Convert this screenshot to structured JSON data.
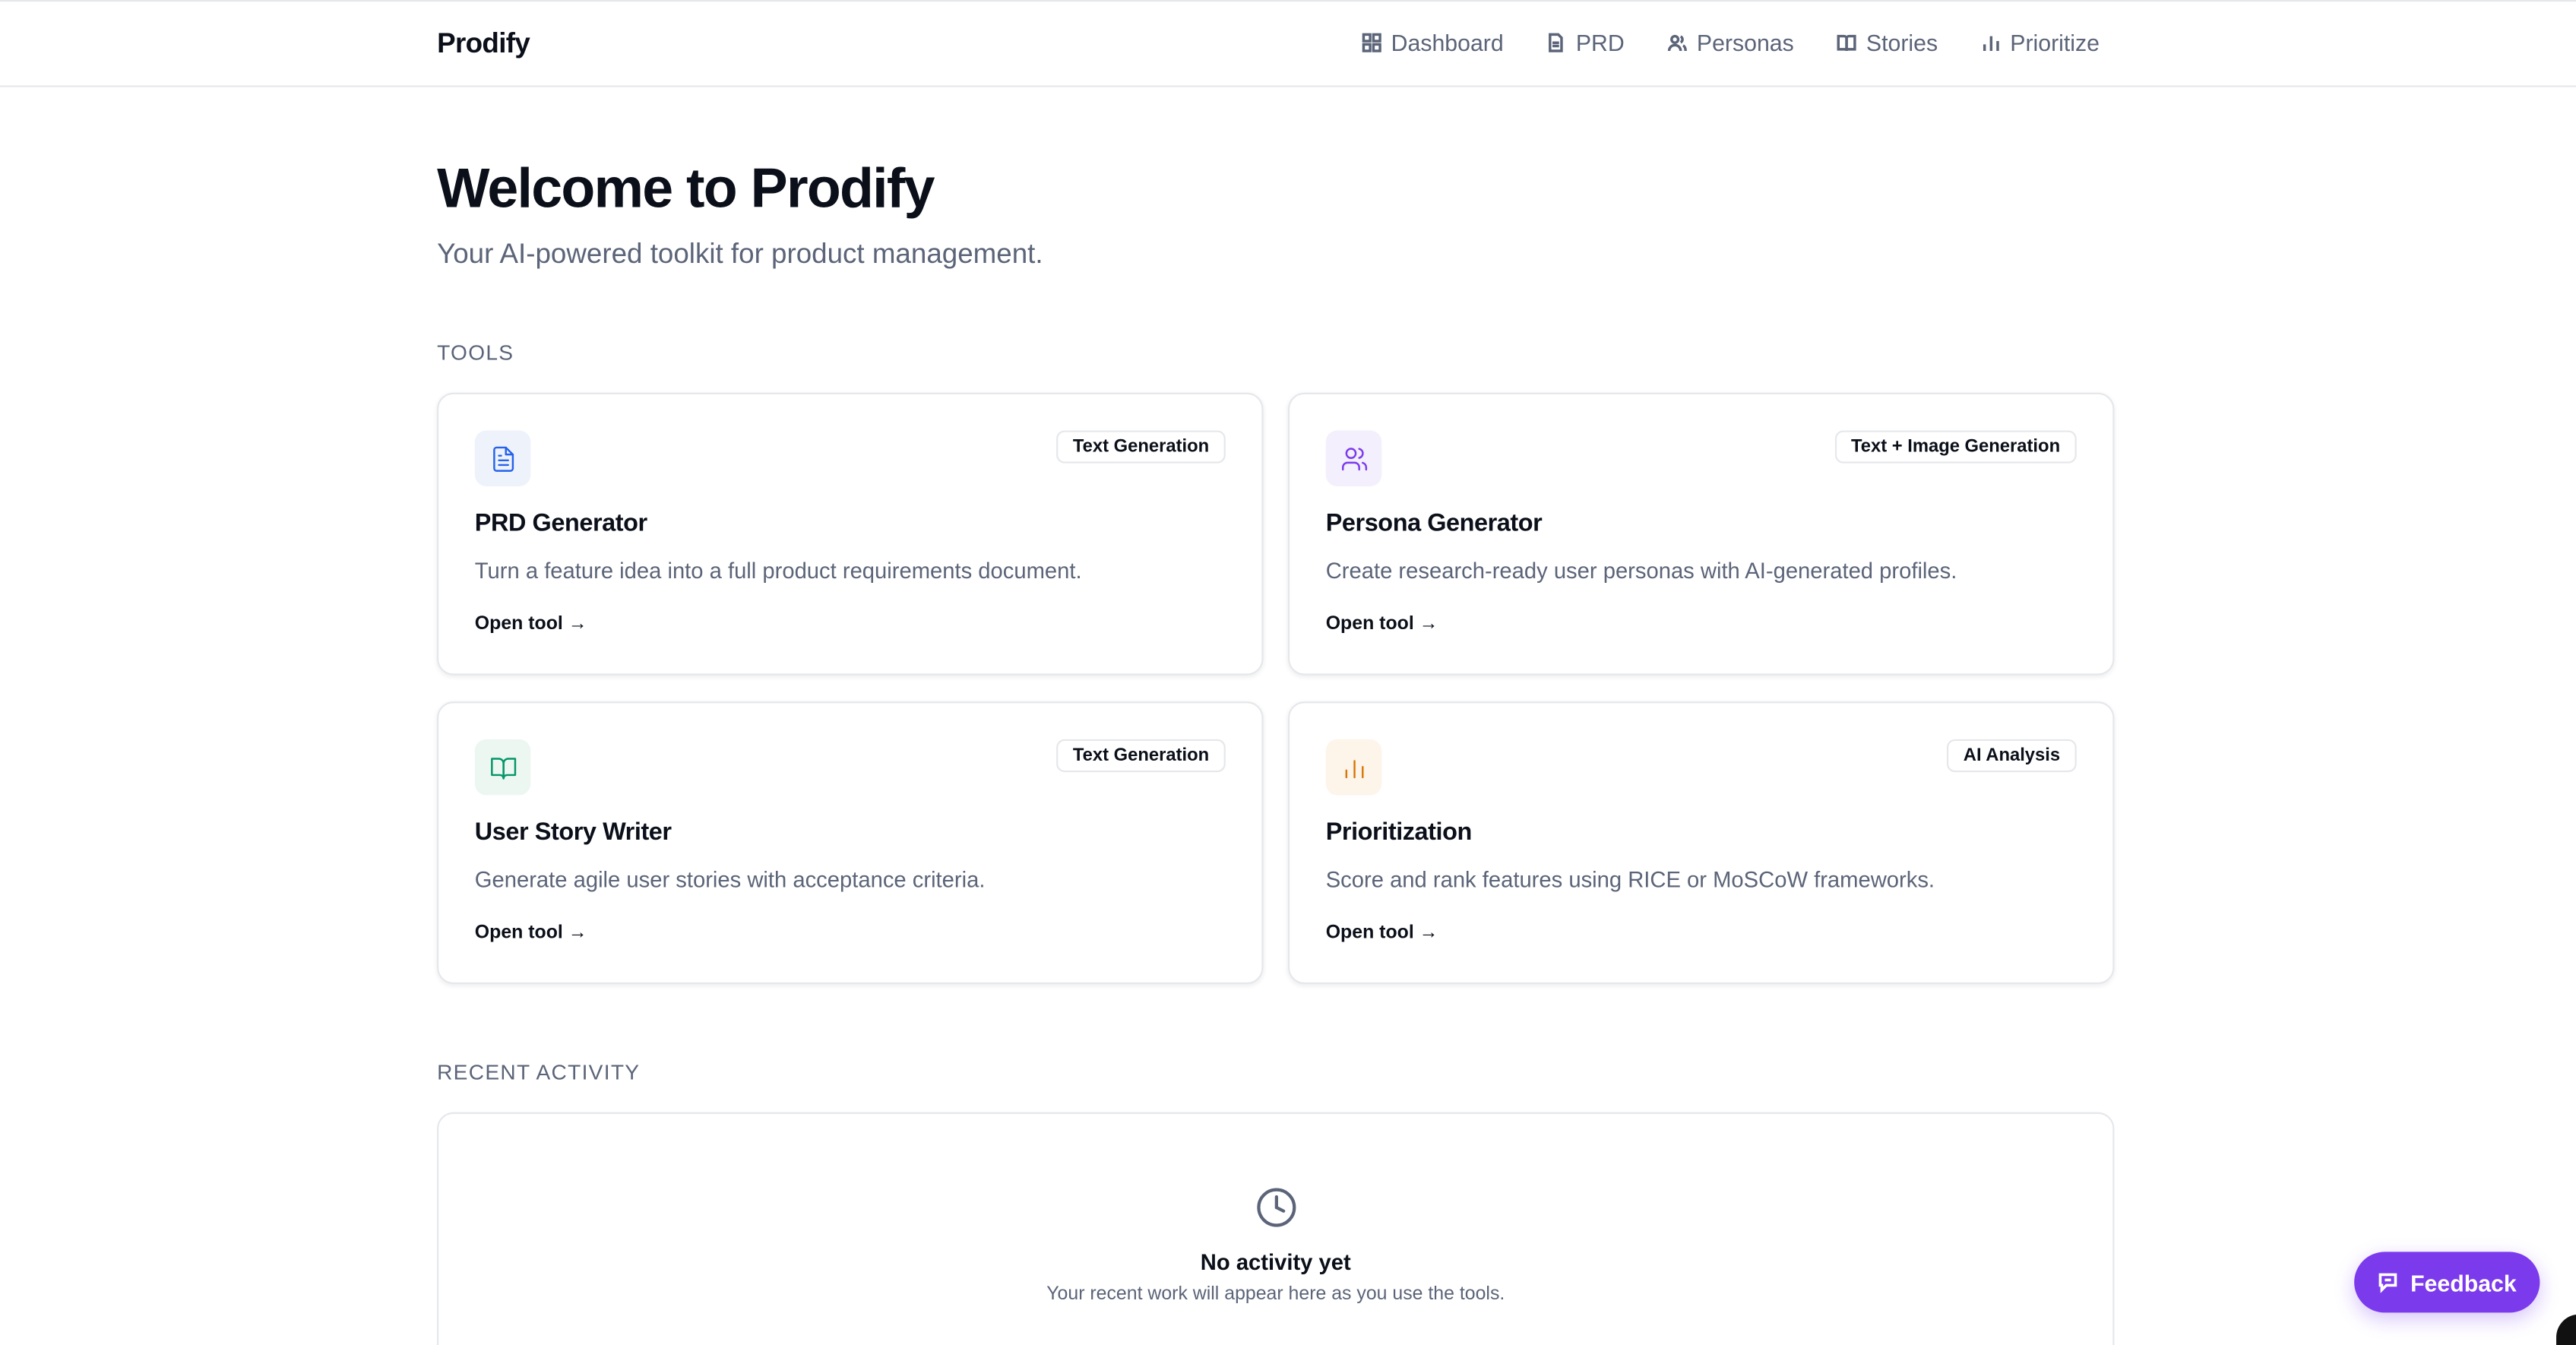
{
  "brand": "Prodify",
  "nav": [
    {
      "label": "Dashboard",
      "icon": "grid-icon"
    },
    {
      "label": "PRD",
      "icon": "document-icon"
    },
    {
      "label": "Personas",
      "icon": "users-icon"
    },
    {
      "label": "Stories",
      "icon": "book-icon"
    },
    {
      "label": "Prioritize",
      "icon": "bar-chart-icon"
    }
  ],
  "hero": {
    "title": "Welcome to Prodify",
    "subtitle": "Your AI-powered toolkit for product management."
  },
  "tools_label": "TOOLS",
  "tools": [
    {
      "title": "PRD Generator",
      "badge": "Text Generation",
      "description": "Turn a feature idea into a full product requirements document.",
      "link": "Open tool →",
      "icon": "document-icon",
      "color": "#2563eb",
      "bg": "#eef2fb"
    },
    {
      "title": "Persona Generator",
      "badge": "Text + Image Generation",
      "description": "Create research-ready user personas with AI-generated profiles.",
      "link": "Open tool →",
      "icon": "users-icon",
      "color": "#7c3aed",
      "bg": "#f3effc"
    },
    {
      "title": "User Story Writer",
      "badge": "Text Generation",
      "description": "Generate agile user stories with acceptance criteria.",
      "link": "Open tool →",
      "icon": "book-icon",
      "color": "#059669",
      "bg": "#ecf7f2"
    },
    {
      "title": "Prioritization",
      "badge": "AI Analysis",
      "description": "Score and rank features using RICE or MoSCoW frameworks.",
      "link": "Open tool →",
      "icon": "bar-chart-icon",
      "color": "#d97706",
      "bg": "#fdf4ea"
    }
  ],
  "activity": {
    "label": "RECENT ACTIVITY",
    "empty_title": "No activity yet",
    "empty_subtitle": "Your recent work will appear here as you use the tools."
  },
  "feedback": {
    "label": "Feedback"
  }
}
